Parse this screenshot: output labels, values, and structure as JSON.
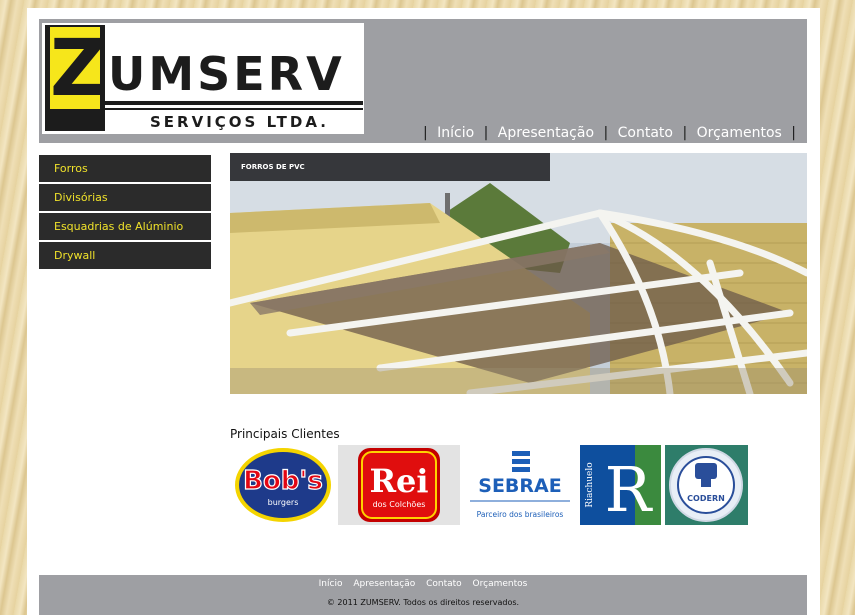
{
  "logo": {
    "letter": "Z",
    "word": "UMSERV",
    "tagline": "SERVIÇOS LTDA."
  },
  "topnav": {
    "separator": "|",
    "items": [
      "Início",
      "Apresentação",
      "Contato",
      "Orçamentos"
    ]
  },
  "sidebar": {
    "items": [
      "Forros",
      "Divisórias",
      "Esquadrias de Alúminio",
      "Drywall"
    ]
  },
  "banner": {
    "caption": "FORROS DE PVC"
  },
  "clients": {
    "title": "Principais Clientes",
    "logos": [
      {
        "main": "Bob's",
        "sub": "burgers"
      },
      {
        "main": "Rei",
        "sub": "dos Colchões"
      },
      {
        "main": "SEBRAE",
        "sub": "Parceiro dos brasileiros"
      },
      {
        "main": "R",
        "sub": "Riachuelo"
      },
      {
        "main": "CODERN",
        "sub": ""
      }
    ]
  },
  "footer": {
    "links": [
      "Início",
      "Apresentação",
      "Contato",
      "Orçamentos"
    ],
    "copyright": "© 2011 ZUMSERV. Todos os direitos reservados."
  },
  "colors": {
    "header_gray": "#9e9fa3",
    "logo_yellow": "#f6e61b",
    "menu_bg": "#2b2b2b",
    "menu_text": "#f0e22b"
  }
}
